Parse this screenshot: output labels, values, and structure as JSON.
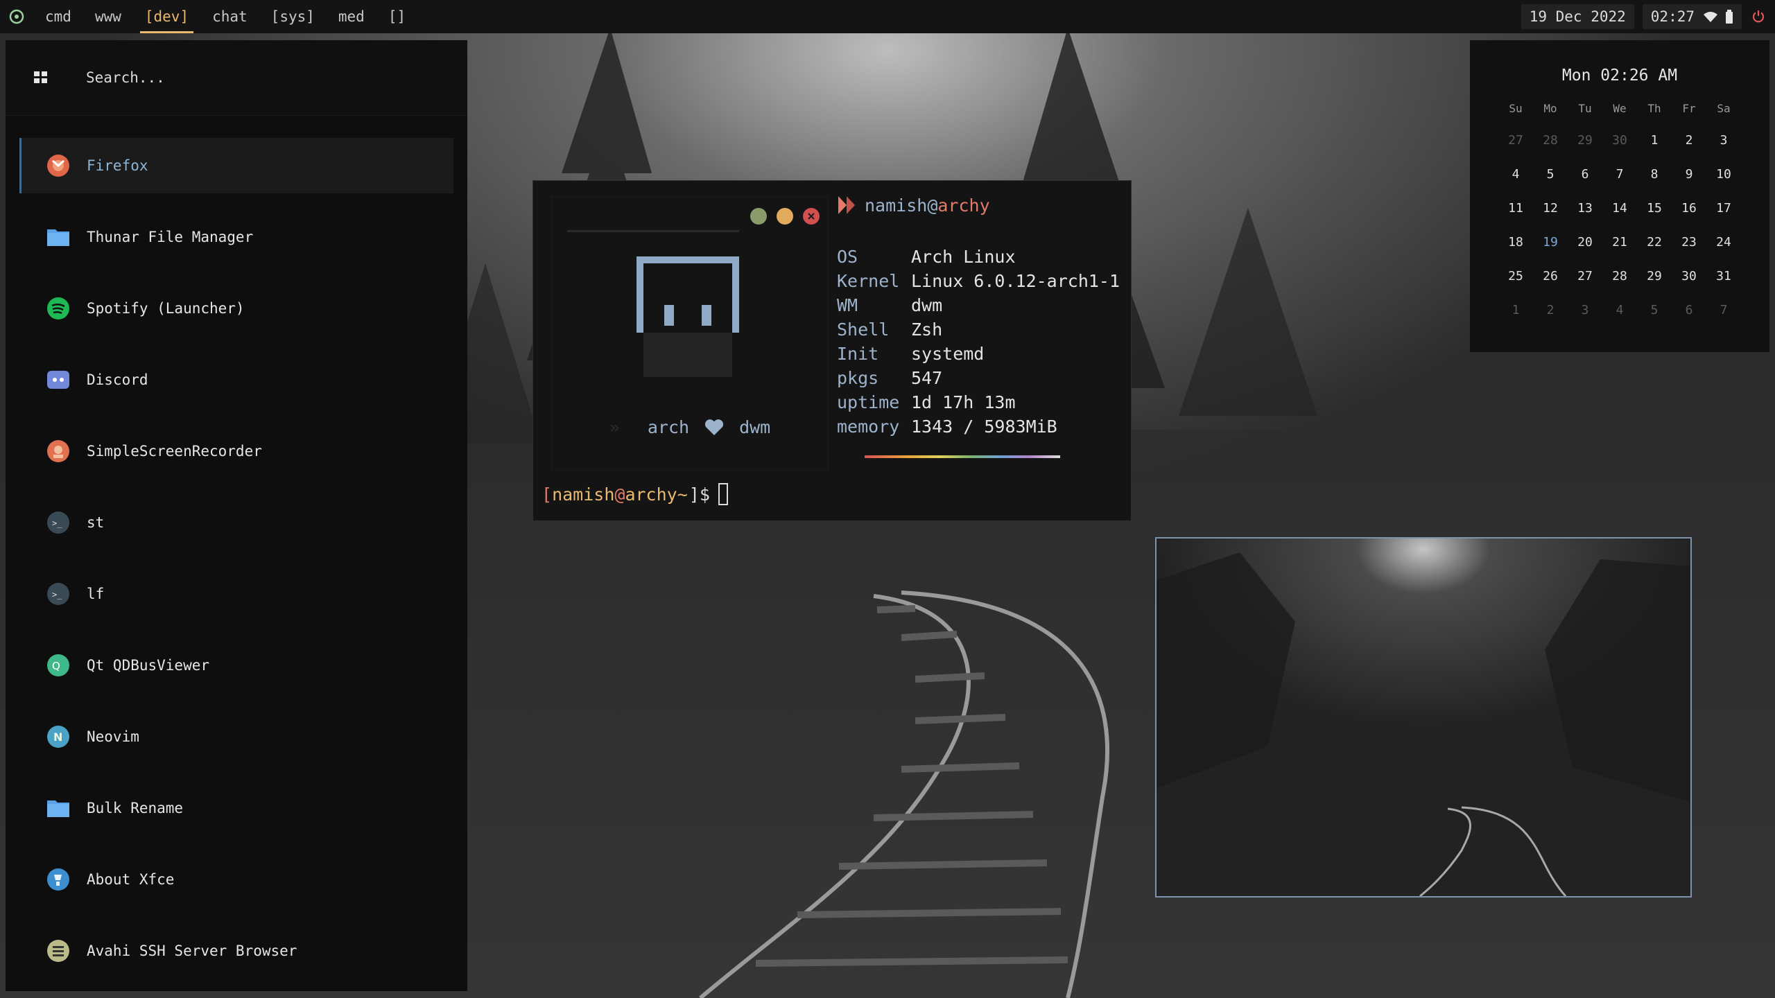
{
  "topbar": {
    "tags": [
      "cmd",
      "www",
      "[dev]",
      "chat",
      "[sys]",
      "med",
      "[]"
    ],
    "active_tag": "[dev]",
    "date": "19 Dec 2022",
    "time": "02:27",
    "icons": [
      "arch-logo-icon",
      "wifi-icon",
      "battery-icon",
      "power-icon"
    ]
  },
  "launcher": {
    "search_placeholder": "Search...",
    "apps": [
      {
        "name": "Firefox",
        "icon": "firefox-icon",
        "selected": true
      },
      {
        "name": "Thunar File Manager",
        "icon": "folder-icon"
      },
      {
        "name": "Spotify (Launcher)",
        "icon": "spotify-icon"
      },
      {
        "name": "Discord",
        "icon": "discord-icon"
      },
      {
        "name": "SimpleScreenRecorder",
        "icon": "recorder-icon"
      },
      {
        "name": "st",
        "icon": "terminal-icon"
      },
      {
        "name": "lf",
        "icon": "terminal-icon"
      },
      {
        "name": "Qt QDBusViewer",
        "icon": "qt-icon"
      },
      {
        "name": "Neovim",
        "icon": "neovim-icon"
      },
      {
        "name": "Bulk Rename",
        "icon": "folder-icon"
      },
      {
        "name": "About Xfce",
        "icon": "xfce-icon"
      },
      {
        "name": "Avahi SSH Server Browser",
        "icon": "avahi-icon"
      }
    ]
  },
  "terminal": {
    "user": "namish",
    "at": "@",
    "host": "archy",
    "art_left": "arch",
    "art_right": "dwm",
    "info": [
      {
        "key": "OS",
        "value": "Arch Linux"
      },
      {
        "key": "Kernel",
        "value": "Linux 6.0.12-arch1-1"
      },
      {
        "key": "WM",
        "value": "dwm"
      },
      {
        "key": "Shell",
        "value": "Zsh"
      },
      {
        "key": "Init",
        "value": "systemd"
      },
      {
        "key": "pkgs",
        "value": "547"
      },
      {
        "key": "uptime",
        "value": "1d 17h 13m"
      },
      {
        "key": "memory",
        "value": "1343 / 5983MiB"
      }
    ],
    "prompt": {
      "open": "[",
      "user": "namish",
      "at": "@",
      "host": "archy",
      "path": " ~",
      "close": "]$"
    },
    "window_buttons": [
      "minimize",
      "maximize",
      "close"
    ]
  },
  "calendar": {
    "title": "Mon 02:26 AM",
    "weekdays": [
      "Su",
      "Mo",
      "Tu",
      "We",
      "Th",
      "Fr",
      "Sa"
    ],
    "weeks": [
      [
        {
          "d": "27",
          "dim": true
        },
        {
          "d": "28",
          "dim": true
        },
        {
          "d": "29",
          "dim": true
        },
        {
          "d": "30",
          "dim": true
        },
        {
          "d": "1"
        },
        {
          "d": "2"
        },
        {
          "d": "3"
        }
      ],
      [
        {
          "d": "4"
        },
        {
          "d": "5"
        },
        {
          "d": "6"
        },
        {
          "d": "7"
        },
        {
          "d": "8"
        },
        {
          "d": "9"
        },
        {
          "d": "10"
        }
      ],
      [
        {
          "d": "11"
        },
        {
          "d": "12"
        },
        {
          "d": "13"
        },
        {
          "d": "14"
        },
        {
          "d": "15"
        },
        {
          "d": "16"
        },
        {
          "d": "17"
        }
      ],
      [
        {
          "d": "18"
        },
        {
          "d": "19",
          "today": true
        },
        {
          "d": "20"
        },
        {
          "d": "21"
        },
        {
          "d": "22"
        },
        {
          "d": "23"
        },
        {
          "d": "24"
        }
      ],
      [
        {
          "d": "25"
        },
        {
          "d": "26"
        },
        {
          "d": "27"
        },
        {
          "d": "28"
        },
        {
          "d": "29"
        },
        {
          "d": "30"
        },
        {
          "d": "31"
        }
      ],
      [
        {
          "d": "1",
          "dim": true
        },
        {
          "d": "2",
          "dim": true
        },
        {
          "d": "3",
          "dim": true
        },
        {
          "d": "4",
          "dim": true
        },
        {
          "d": "5",
          "dim": true
        },
        {
          "d": "6",
          "dim": true
        },
        {
          "d": "7",
          "dim": true
        }
      ]
    ]
  },
  "colors": {
    "accent": "#e9b96e",
    "blue": "#9db3cc",
    "red": "#e57a6b",
    "selected_border": "#3e6a8e",
    "preview_border": "#7d93ad"
  }
}
